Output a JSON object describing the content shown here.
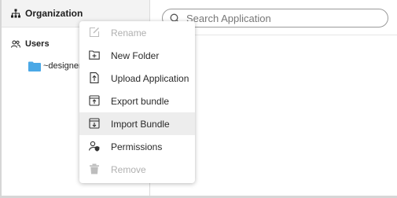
{
  "sidebar": {
    "organization_label": "Organization",
    "users_label": "Users",
    "designer_label": "~designer"
  },
  "search": {
    "placeholder": "Search Application",
    "value": ""
  },
  "context_menu": {
    "items": [
      {
        "label": "Rename",
        "icon": "rename-icon",
        "enabled": false,
        "highlighted": false
      },
      {
        "label": "New Folder",
        "icon": "new-folder-icon",
        "enabled": true,
        "highlighted": false
      },
      {
        "label": "Upload Application",
        "icon": "upload-icon",
        "enabled": true,
        "highlighted": false
      },
      {
        "label": "Export bundle",
        "icon": "export-icon",
        "enabled": true,
        "highlighted": false
      },
      {
        "label": "Import Bundle",
        "icon": "import-icon",
        "enabled": true,
        "highlighted": true
      },
      {
        "label": "Permissions",
        "icon": "permissions-icon",
        "enabled": true,
        "highlighted": false
      },
      {
        "label": "Remove",
        "icon": "trash-icon",
        "enabled": false,
        "highlighted": false
      }
    ]
  },
  "colors": {
    "folder": "#4aa8e6",
    "highlight": "#ededed",
    "disabled_text": "#b0b0b0"
  }
}
